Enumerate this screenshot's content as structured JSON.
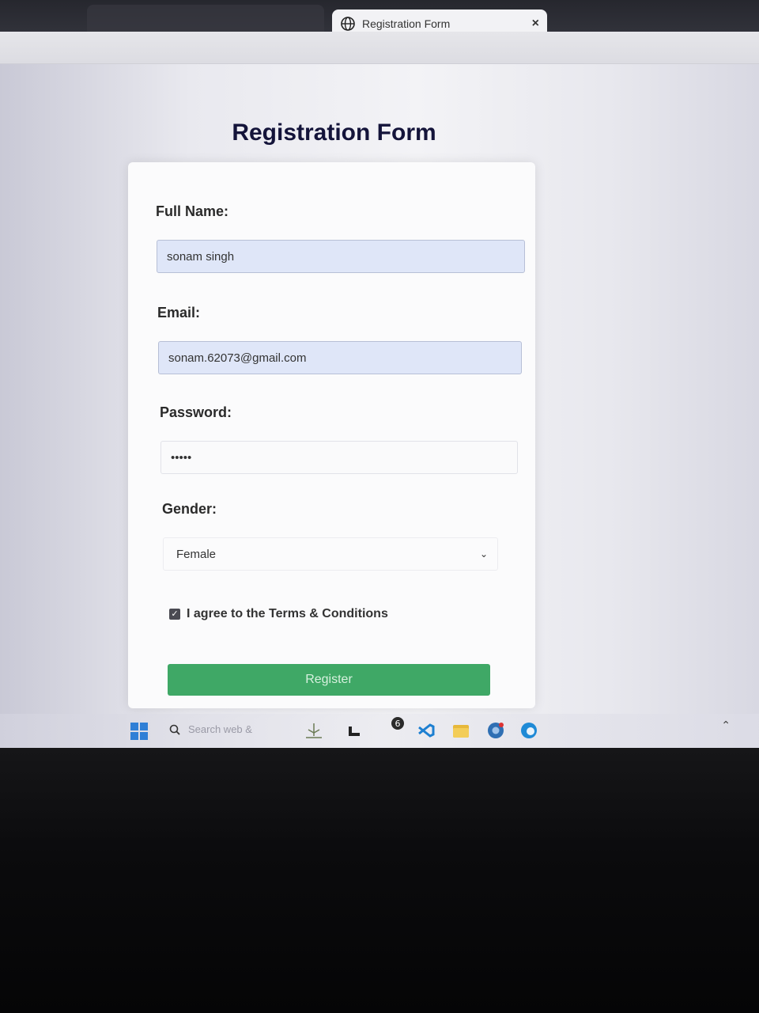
{
  "browser": {
    "tab_title": "Registration Form",
    "tab_close": "×"
  },
  "form": {
    "title": "Registration Form",
    "full_name_label": "Full Name:",
    "full_name_value": "sonam singh",
    "email_label": "Email:",
    "email_value": "sonam.62073@gmail.com",
    "password_label": "Password:",
    "password_value": "•••••",
    "gender_label": "Gender:",
    "gender_value": "Female",
    "terms_label": "I agree to the Terms & Conditions",
    "terms_checked": true,
    "register_label": "Register",
    "accent_color": "#3fa866"
  },
  "taskbar": {
    "search_placeholder": "Search web &"
  }
}
